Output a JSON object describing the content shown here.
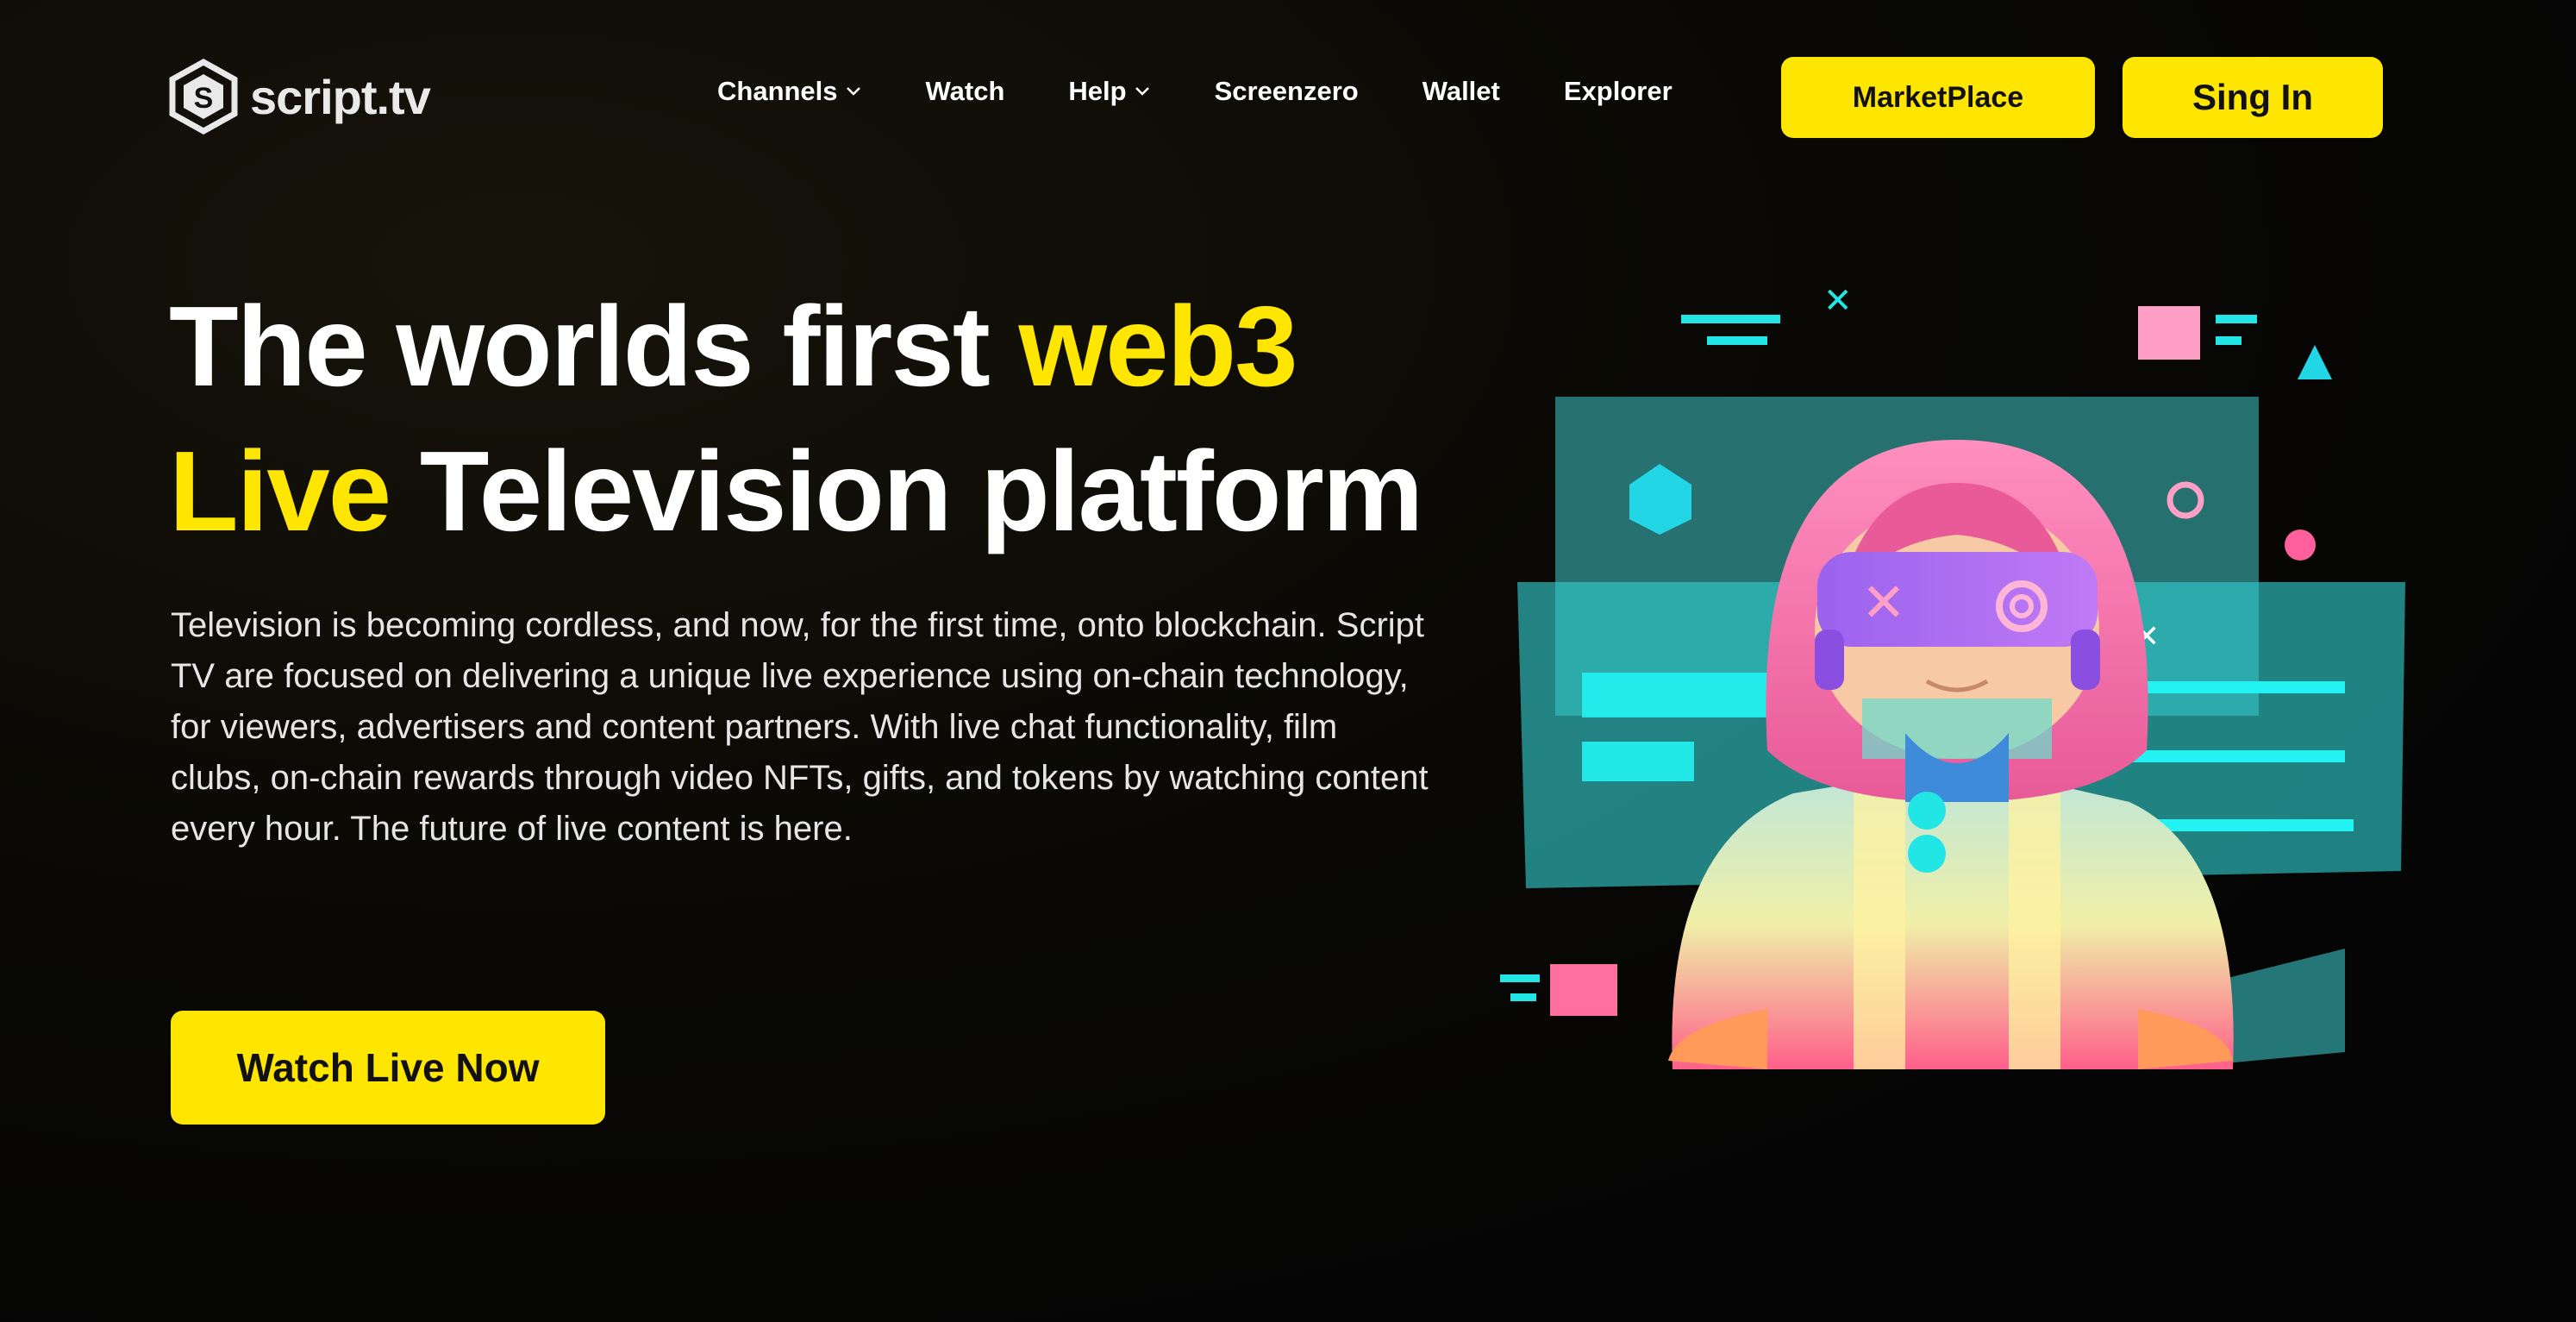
{
  "brand": {
    "name": "script.tv",
    "logo_letter": "S"
  },
  "nav": {
    "items": [
      {
        "label": "Channels",
        "has_dropdown": true
      },
      {
        "label": "Watch",
        "has_dropdown": false
      },
      {
        "label": "Help",
        "has_dropdown": true
      },
      {
        "label": "Screenzero",
        "has_dropdown": false
      },
      {
        "label": "Wallet",
        "has_dropdown": false
      },
      {
        "label": "Explorer",
        "has_dropdown": false
      }
    ]
  },
  "header": {
    "marketplace_label": "MarketPlace",
    "signin_label": "Sing In"
  },
  "hero": {
    "title_part1": "The worlds first ",
    "title_highlight1": "web3",
    "title_highlight2": "Live",
    "title_part2": " Television platform",
    "description": "Television is becoming cordless, and now, for the first time, onto blockchain. Script TV are focused on delivering a unique live experience using on-chain technology, for viewers, advertisers and content partners. With live chat functionality, film clubs, on-chain rewards through video NFTs, gifts, and tokens by watching content every hour. The future of live content is here.",
    "cta_label": "Watch Live Now"
  },
  "colors": {
    "accent": "#ffe600",
    "background": "#050505",
    "teal": "#3fd3d3",
    "pink": "#ff6fa8",
    "visor": "#a66cf0"
  },
  "illustration": {
    "name": "vr-hooded-character-illustration"
  }
}
